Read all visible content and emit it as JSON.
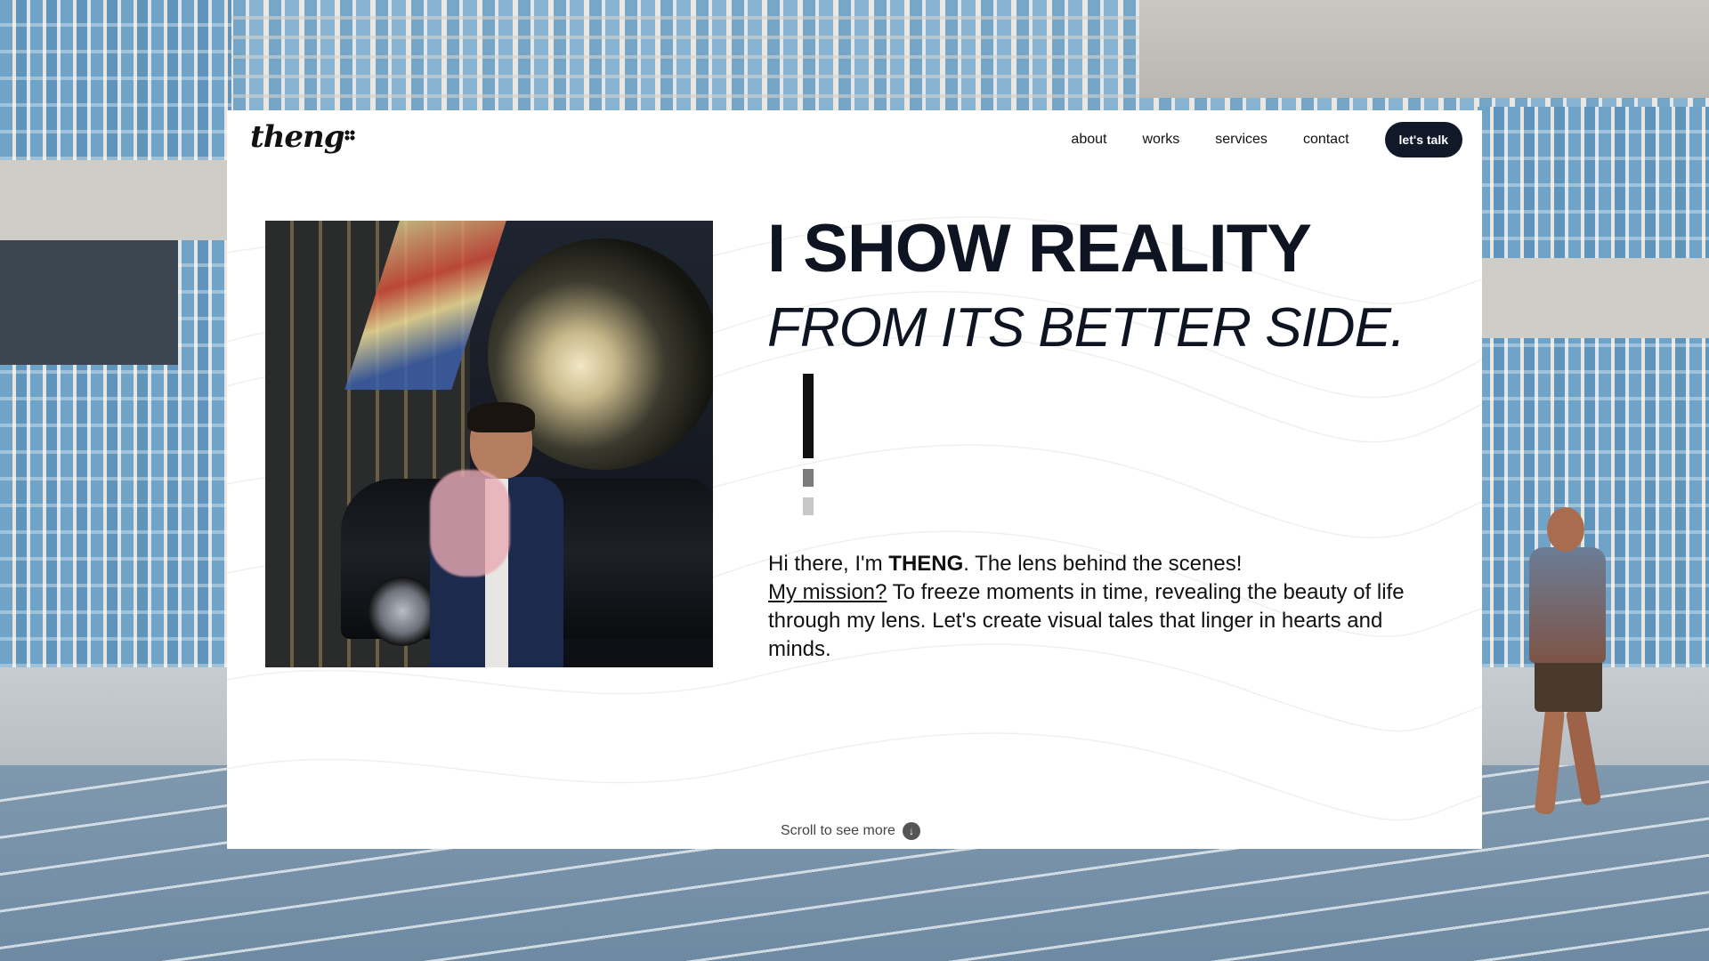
{
  "brand": {
    "logo_text": "theng"
  },
  "nav": {
    "items": [
      "about",
      "works",
      "services",
      "contact"
    ],
    "cta_label": "let's talk"
  },
  "hero": {
    "title": "I SHOW REALITY",
    "subtitle": "FROM ITS BETTER SIDE.",
    "intro_prefix": "Hi there, I'm ",
    "intro_name": "THENG",
    "intro_suffix": ". The lens behind the scenes!",
    "mission_link": "My mission?",
    "mission_text": " To freeze moments in time, revealing the beauty of life through my lens. Let's create visual tales that linger in hearts and minds."
  },
  "scroll": {
    "label": "Scroll to see more",
    "icon": "arrow-down-icon"
  },
  "colors": {
    "text": "#0e1421",
    "cta_bg": "#111827",
    "card_bg": "#ffffff"
  }
}
